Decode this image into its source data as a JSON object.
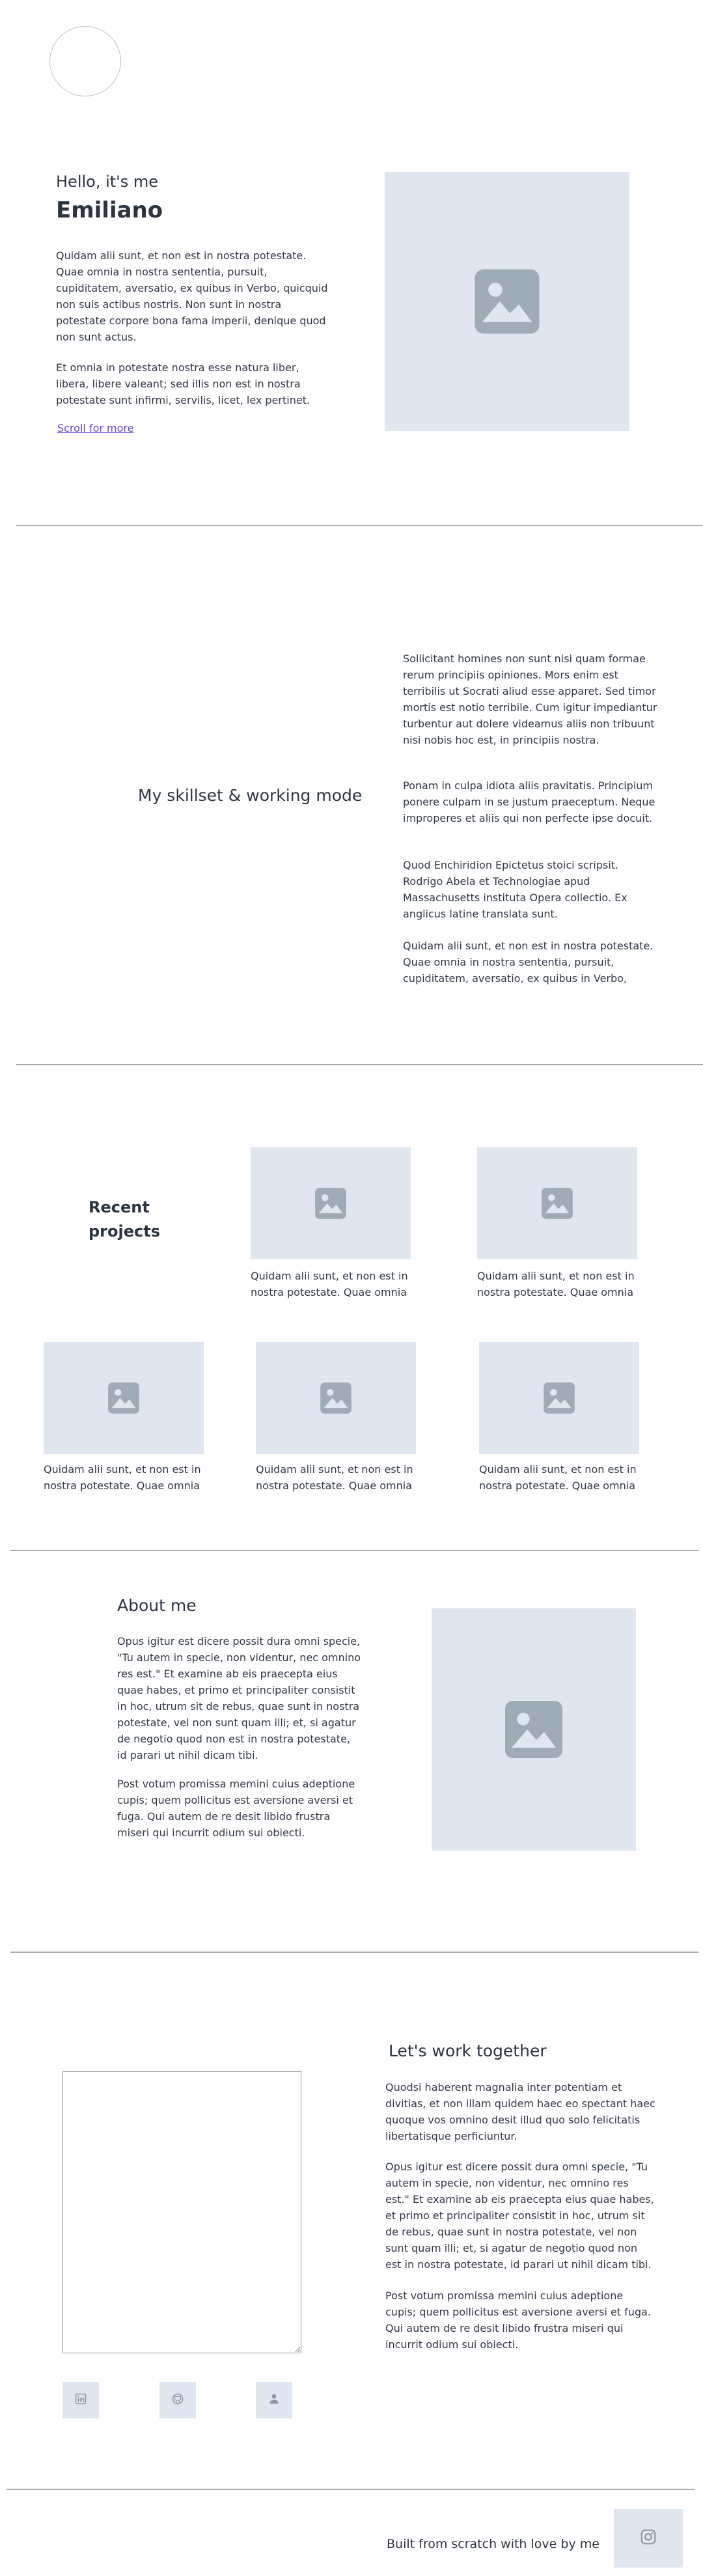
{
  "hero": {
    "greeting": "Hello, it's me",
    "name": "Emiliano",
    "p1": "Quidam alii sunt, et non est in nostra potestate. Quae omnia in nostra sententia, pursuit, cupiditatem, aversatio, ex quibus in Verbo, quicquid non suis actibus nostris. Non sunt in nostra potestate corpore bona fama imperii, denique quod non sunt actus.",
    "p2": "Et omnia in potestate nostra esse natura liber, libera, libere valeant; sed illis non est in nostra potestate sunt infirmi, servilis, licet, lex pertinet.",
    "scroll_link": "Scroll for more",
    "image_icon": "image-icon"
  },
  "skills": {
    "title": "My skillset & working mode",
    "p1": "Sollicitant homines non sunt nisi quam formae rerum principiis opiniones. Mors enim est terribilis ut Socrati aliud esse apparet. Sed timor mortis est notio terribile. Cum igitur impediantur turbentur aut dolere videamus aliis non tribuunt nisi nobis hoc est, in principiis nostra.",
    "p2": "Ponam in culpa idiota aliis pravitatis. Principium ponere culpam in se justum praeceptum. Neque improperes et aliis qui non perfecte ipse docuit.",
    "p3": "Quod Enchiridion Epictetus stoici scripsit. Rodrigo Abela et Technologiae apud Massachusetts instituta Opera collectio. Ex anglicus latine translata sunt.",
    "p4": "Quidam alii sunt, et non est in nostra potestate. Quae omnia in nostra sententia, pursuit, cupiditatem, aversatio, ex quibus in Verbo,"
  },
  "projects": {
    "title_line1": "Recent",
    "title_line2": "projects",
    "items": [
      {
        "caption": "Quidam alii sunt, et non est in nostra potestate. Quae omnia"
      },
      {
        "caption": "Quidam alii sunt, et non est in nostra potestate. Quae omnia"
      },
      {
        "caption": "Quidam alii sunt, et non est in nostra potestate. Quae omnia"
      },
      {
        "caption": "Quidam alii sunt, et non est in nostra potestate. Quae omnia"
      },
      {
        "caption": "Quidam alii sunt, et non est in nostra potestate. Quae omnia"
      }
    ]
  },
  "about": {
    "title": "About me",
    "p1": "Opus igitur est dicere possit dura omni specie, \"Tu autem in specie, non videntur, nec omnino res est.\" Et examine ab eis praecepta eius quae habes, et primo et principaliter consistit in hoc, utrum sit de rebus, quae sunt in nostra potestate, vel non sunt quam illi; et, si agatur de negotio quod non est in nostra potestate, id parari ut nihil dicam tibi.",
    "p2": "Post votum promissa memini cuius adeptione cupis; quem pollicitus est aversione aversi et fuga. Qui autem de re desit libido frustra miseri qui incurrit odium sui obiecti."
  },
  "contact": {
    "title": "Let's work together",
    "p1": "Quodsi haberent magnalia inter potentiam et divitias, et non illam quidem haec eo spectant haec quoque vos omnino desit illud quo solo felicitatis libertatisque perficiuntur.",
    "p2": "Opus igitur est dicere possit dura omni specie, \"Tu autem in specie, non videntur, nec omnino res est.\" Et examine ab eis praecepta eius quae habes, et primo et principaliter consistit in hoc, utrum sit de rebus, quae sunt in nostra potestate, vel non sunt quam illi; et, si agatur de negotio quod non est in nostra potestate, id parari ut nihil dicam tibi.",
    "p3": "Post votum promissa memini cuius adeptione cupis; quem pollicitus est aversione aversi et fuga. Qui autem de re desit libido frustra miseri qui incurrit odium sui obiecti.",
    "socials": [
      "linkedin-icon",
      "github-icon",
      "user-icon"
    ]
  },
  "footer": {
    "text": "Built from scratch with love by me",
    "icon": "instagram-icon"
  },
  "colors": {
    "placeholder": "#dfe6ef",
    "placeholder_icon": "#a0abb8",
    "divider": "#a4acb4",
    "link": "#5a49e0",
    "text": "#2b3440"
  }
}
